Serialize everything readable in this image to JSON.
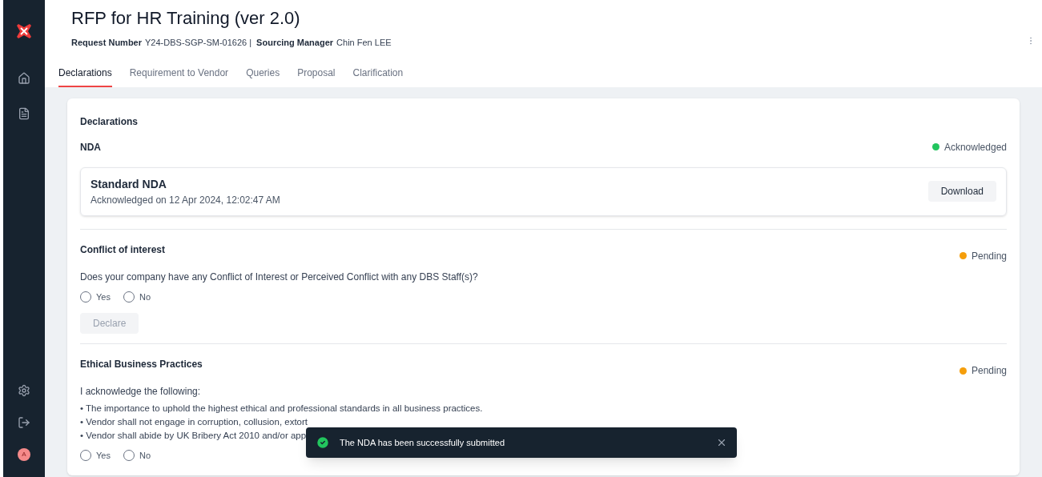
{
  "sidebar": {
    "top_items": [
      {
        "kind": "home",
        "selected": false
      },
      {
        "kind": "document",
        "selected": false
      }
    ],
    "bottom_items": [
      {
        "kind": "settings"
      },
      {
        "kind": "logout"
      }
    ],
    "avatar": "A"
  },
  "header": {
    "title": "RFP for HR Training (ver 2.0)",
    "request_label": "Request Number",
    "request_number": "Y24-DBS-SGP-SM-01626 |",
    "manager_label": "Sourcing Manager",
    "manager": "Chin Fen LEE"
  },
  "tabs": [
    {
      "label": "Declarations",
      "selected": true
    },
    {
      "label": "Requirement to Vendor",
      "selected": false
    },
    {
      "label": "Queries",
      "selected": false
    },
    {
      "label": "Proposal",
      "selected": false
    },
    {
      "label": "Clarification",
      "selected": false
    }
  ],
  "card_title": "Declarations",
  "sections": [
    {
      "kind": "document",
      "title": "NDA",
      "status": "Acknowledged",
      "color": "#22c55e",
      "document": {
        "name": "Standard NDA",
        "note": "Acknowledged on 12 Apr 2024, 12:02:47 AM",
        "button": "Download"
      }
    },
    {
      "kind": "question",
      "title": "Conflict of interest",
      "status": "Pending",
      "color": "#f59e0b",
      "question": "Does your company have any Conflict of Interest or Perceived Conflict with any DBS Staff(s)?",
      "options": [
        {
          "label": "Yes",
          "selected": false
        },
        {
          "label": "No",
          "selected": false
        }
      ],
      "button": {
        "label": "Declare",
        "disabled": true
      }
    },
    {
      "kind": "acknowledge",
      "title": "Ethical Business Practices",
      "status": "Pending",
      "color": "#f59e0b",
      "intro": "I acknowledge the following:",
      "points": [
        "• The importance to uphold the highest ethical and professional standards in all business practices.",
        "• Vendor shall not engage in corruption, collusion, extort",
        "• Vendor shall abide by UK Bribery Act 2010 and/or app"
      ],
      "options": [
        {
          "label": "Yes",
          "selected": false
        },
        {
          "label": "No",
          "selected": false
        }
      ]
    }
  ],
  "toast": {
    "message": "The NDA has been successfully submitted"
  }
}
